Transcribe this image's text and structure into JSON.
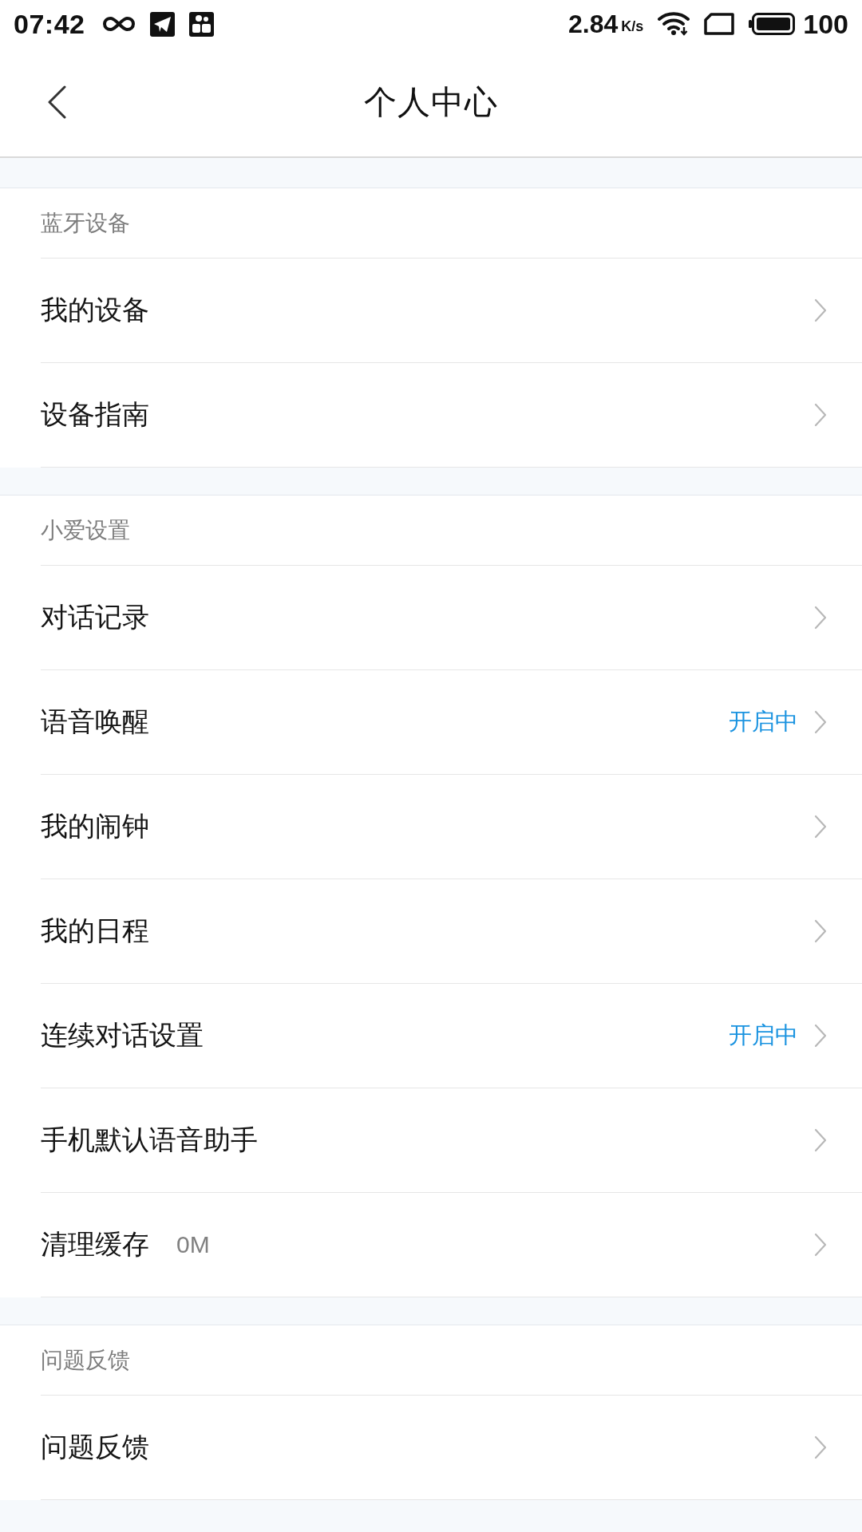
{
  "status_bar": {
    "time": "07:42",
    "net_speed": "2.84",
    "speed_unit": "K/s",
    "battery": "100"
  },
  "header": {
    "title": "个人中心"
  },
  "sections": [
    {
      "title": "蓝牙设备",
      "items": [
        {
          "label": "我的设备"
        },
        {
          "label": "设备指南"
        }
      ]
    },
    {
      "title": "小爱设置",
      "items": [
        {
          "label": "对话记录"
        },
        {
          "label": "语音唤醒",
          "status": "开启中"
        },
        {
          "label": "我的闹钟"
        },
        {
          "label": "我的日程"
        },
        {
          "label": "连续对话设置",
          "status": "开启中"
        },
        {
          "label": "手机默认语音助手"
        },
        {
          "label": "清理缓存",
          "detail": "0M"
        }
      ]
    },
    {
      "title": "问题反馈",
      "items": [
        {
          "label": "问题反馈"
        }
      ]
    }
  ]
}
